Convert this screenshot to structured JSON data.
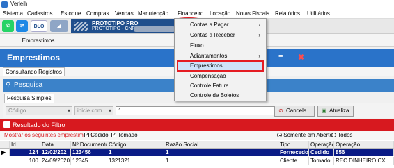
{
  "window": {
    "title": "Verleih"
  },
  "menubar": {
    "items": [
      "Sistema",
      "Cadastros",
      "Estoque",
      "Compras",
      "Vendas",
      "Manutenção",
      "Financeiro",
      "Locação",
      "Notas Fiscais",
      "Relatórios",
      "Utilitários"
    ]
  },
  "toolbar": {
    "icons": [
      "whatsapp-icon",
      "teamviewer-icon",
      "dlo-icon",
      "verleih-logo"
    ],
    "dlo_label": "DLO",
    "company_name": "PROTOTIPO PRO",
    "company_cnpj": "PROTOTIPO - CNPJ :"
  },
  "tabs": {
    "main": "Emprestimos"
  },
  "header": {
    "title": "Emprestimos",
    "icons": [
      "menu-icon",
      "close-red-icon"
    ]
  },
  "subtabs": {
    "consultando": "Consultando Registros"
  },
  "pesquisa": {
    "title": "Pesquisa",
    "tab": "Pesquisa Simples",
    "field_select": "Código",
    "mode_select": "inicie com",
    "term": "1",
    "cancel_label": "Cancela",
    "update_label": "Atualiza"
  },
  "resultado": {
    "title": "Resultado do Filtro",
    "show_label": "Mostrar os seguintes emprestimos :",
    "cedido_label": "Cedido",
    "tomado_label": "Tomado",
    "aberto_label": "Somente em Aberto",
    "todos_label": "Todos"
  },
  "grid": {
    "columns": [
      "Id",
      "Data",
      "Nº.Documento",
      "Código",
      "Razão Social",
      "Tipo",
      "Operação",
      "Operação"
    ],
    "rows": [
      [
        "124",
        "12/02/202",
        "123456",
        "1",
        "1",
        "Fornecedor",
        "Cedido",
        "856"
      ],
      [
        "100",
        "24/09/2020",
        "12345",
        "1321321",
        "1",
        "Cliente",
        "Tomado",
        "REC DINHEIRO CX"
      ]
    ]
  },
  "dropdown": {
    "items": [
      {
        "label": "Contas a Pagar",
        "submenu": true
      },
      {
        "label": "Contas a Receber",
        "submenu": true
      },
      {
        "label": "Fluxo",
        "submenu": false
      },
      {
        "label": "Adiantamentos",
        "submenu": true
      },
      {
        "label": "Emprestimos",
        "submenu": false
      },
      {
        "label": "Compensação",
        "submenu": false
      },
      {
        "label": "Controle Fatura",
        "submenu": false
      },
      {
        "label": "Controle de Boletos",
        "submenu": false
      }
    ]
  },
  "colors": {
    "header_blue": "#2a73c9",
    "result_red": "#d7191f",
    "highlight": "#e51c23",
    "row_select": "#0a1b86"
  }
}
